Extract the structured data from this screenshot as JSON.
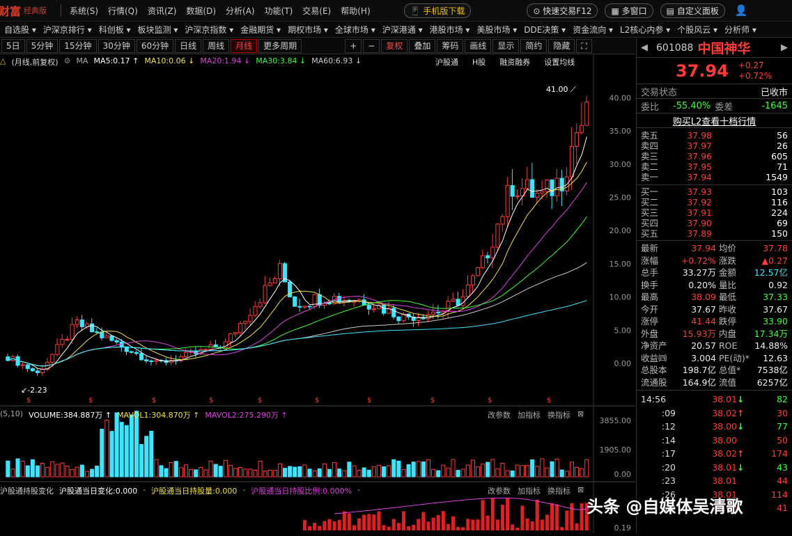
{
  "app": {
    "logo": "财富",
    "logo_sub": "经典版"
  },
  "menu": [
    "系统(S)",
    "行情(Q)",
    "资讯(Z)",
    "数据(D)",
    "分析(A)",
    "功能(T)",
    "交易(E)",
    "帮助(H)"
  ],
  "menu_buttons": {
    "mobile": "手机版下载",
    "quick_trade": "快速交易F12",
    "multi_window": "多窗口",
    "custom_panel": "自定义面板"
  },
  "nav": [
    "自选股",
    "沪深京排行",
    "科创板",
    "板块监测",
    "沪深京指数",
    "金融期货",
    "期权市场",
    "全球市场",
    "沪深港通",
    "港股市场",
    "美股市场",
    "DDE决策",
    "资金流向",
    "L2核心内参",
    "个股风云",
    "分析师"
  ],
  "toolbar": {
    "periods": [
      "5日",
      "5分钟",
      "15分钟",
      "30分钟",
      "60分钟",
      "日线",
      "周线",
      "月线",
      "更多周期"
    ],
    "active_period": "月线",
    "tools": [
      "复权",
      "叠加",
      "筹码",
      "画线",
      "显示",
      "简约",
      "隐藏"
    ]
  },
  "ma_bar": {
    "prefix": "(月线,前复权)",
    "ma": "MA",
    "ma5": "MA5:0.17",
    "ma10": "MA10:0.06",
    "ma20": "MA20:1.94",
    "ma30": "MA30:3.84",
    "ma60": "MA60:6.93",
    "links": [
      "沪股通",
      "H股",
      "融资融券",
      "设置均线"
    ]
  },
  "price_axis": [
    "40.00",
    "35.00",
    "30.00",
    "25.00",
    "20.00",
    "15.00",
    "10.00",
    "5.00",
    "0.00"
  ],
  "annotations": {
    "high": "41.00",
    "low": "-2.23"
  },
  "volume_bar": {
    "prefix": "(5,10)",
    "volume": "VOLUME:384.887万",
    "mavol1": "MAVOL1:304.870万",
    "mavol2": "MAVOL2:275.290万",
    "links": [
      "改参数",
      "加指标",
      "换指标"
    ]
  },
  "volume_axis": [
    "3855.00",
    "1905.00",
    "0.00"
  ],
  "hk_bar": {
    "prefix": "沪股通持股变化",
    "change": "沪股通当日变化:0.000",
    "hold": "沪股通当日持股量:0.000",
    "ratio": "沪股通当日持股比例:0.000%",
    "links": [
      "改参数",
      "加指标",
      "换指标"
    ]
  },
  "hk_axis": [
    "0.19"
  ],
  "quote": {
    "code": "601088",
    "name": "中国神华",
    "price": "37.94",
    "change": "+0.27",
    "change_pct": "+0.72%",
    "status_label": "交易状态",
    "status": "已收市",
    "weibi_label": "委比",
    "weibi": "-55.40%",
    "weicha_label": "委差",
    "weicha": "-1645",
    "l2_link": "购买L2查看十档行情"
  },
  "order_book": {
    "sells": [
      {
        "label": "卖五",
        "price": "37.98",
        "vol": "56"
      },
      {
        "label": "卖四",
        "price": "37.97",
        "vol": "26"
      },
      {
        "label": "卖三",
        "price": "37.96",
        "vol": "605"
      },
      {
        "label": "卖二",
        "price": "37.95",
        "vol": "71"
      },
      {
        "label": "卖一",
        "price": "37.94",
        "vol": "1549"
      }
    ],
    "buys": [
      {
        "label": "买一",
        "price": "37.93",
        "vol": "103"
      },
      {
        "label": "买二",
        "price": "37.92",
        "vol": "116"
      },
      {
        "label": "买三",
        "price": "37.91",
        "vol": "224"
      },
      {
        "label": "买四",
        "price": "37.90",
        "vol": "69"
      },
      {
        "label": "买五",
        "price": "37.89",
        "vol": "150"
      }
    ]
  },
  "stats": [
    {
      "l1": "最新",
      "v1": "37.94",
      "c1": "red",
      "l2": "均价",
      "v2": "37.78",
      "c2": "red"
    },
    {
      "l1": "涨幅",
      "v1": "+0.72%",
      "c1": "red",
      "l2": "涨跌",
      "v2": "▲0.27",
      "c2": "red"
    },
    {
      "l1": "总手",
      "v1": "33.27万",
      "c1": "white",
      "l2": "金额",
      "v2": "12.57亿",
      "c2": "cyan"
    },
    {
      "l1": "换手",
      "v1": "0.20%",
      "c1": "white",
      "l2": "量比",
      "v2": "0.92",
      "c2": "white"
    },
    {
      "l1": "最高",
      "v1": "38.09",
      "c1": "red",
      "l2": "最低",
      "v2": "37.33",
      "c2": "green"
    },
    {
      "l1": "今开",
      "v1": "37.67",
      "c1": "white",
      "l2": "昨收",
      "v2": "37.67",
      "c2": "white"
    },
    {
      "l1": "涨停",
      "v1": "41.44",
      "c1": "red",
      "l2": "跌停",
      "v2": "33.90",
      "c2": "green"
    },
    {
      "l1": "外盘",
      "v1": "15.93万",
      "c1": "red",
      "l2": "内盘",
      "v2": "17.34万",
      "c2": "green"
    },
    {
      "l1": "净资产",
      "v1": "20.57",
      "c1": "white",
      "l2": "ROE",
      "v2": "14.88%",
      "c2": "white"
    },
    {
      "l1": "收益㈣",
      "v1": "3.004",
      "c1": "white",
      "l2": "PE(动)*",
      "v2": "12.63",
      "c2": "white"
    },
    {
      "l1": "总股本",
      "v1": "198.7亿",
      "c1": "white",
      "l2": "总值*",
      "v2": "7538亿",
      "c2": "white"
    },
    {
      "l1": "流通股",
      "v1": "164.9亿",
      "c1": "white",
      "l2": "流值",
      "v2": "6257亿",
      "c2": "white"
    }
  ],
  "ticks": [
    {
      "t": "14:56",
      "p": "38.01",
      "d": "down",
      "v": "82"
    },
    {
      "t": ":09",
      "p": "38.02",
      "d": "up",
      "v": "30"
    },
    {
      "t": ":12",
      "p": "38.00",
      "d": "down",
      "v": "77"
    },
    {
      "t": ":14",
      "p": "38.00",
      "d": "",
      "v": "50"
    },
    {
      "t": ":17",
      "p": "38.02",
      "d": "up",
      "v": "174"
    },
    {
      "t": ":20",
      "p": "38.01",
      "d": "down",
      "v": "43"
    },
    {
      "t": ":23",
      "p": "38.01",
      "d": "",
      "v": "44"
    },
    {
      "t": ":26",
      "p": "38.01",
      "d": "",
      "v": "114"
    },
    {
      "t": ":29",
      "p": "38.00",
      "d": "",
      "v": "41"
    }
  ],
  "watermark": "头条 @自媒体吴清歌"
}
